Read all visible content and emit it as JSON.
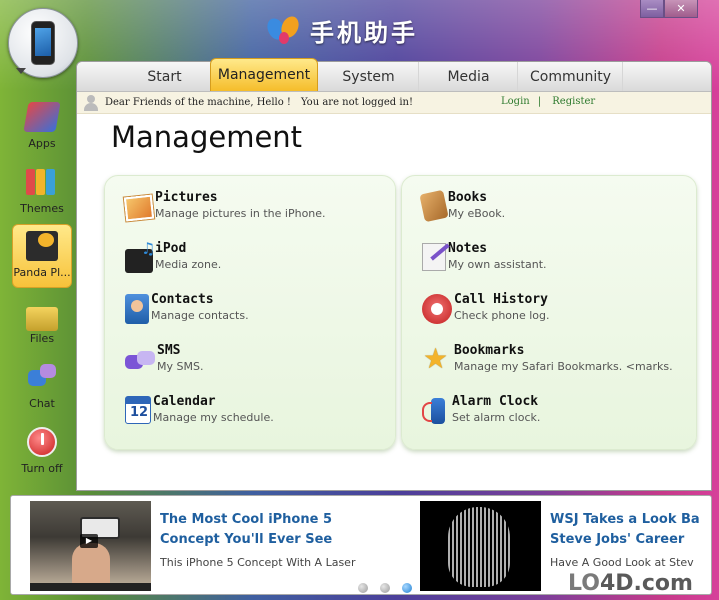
{
  "app": {
    "title": "手机助手"
  },
  "window_controls": {
    "minimize": "—",
    "close": "✕"
  },
  "sidebar": {
    "items": [
      {
        "label": "Apps",
        "icon": "apps-icon",
        "active": false
      },
      {
        "label": "Themes",
        "icon": "themes-icon",
        "active": false
      },
      {
        "label": "Panda Pl...",
        "icon": "panda-player-icon",
        "active": true
      },
      {
        "label": "Files",
        "icon": "folder-icon",
        "active": false
      },
      {
        "label": "Chat",
        "icon": "chat-icon",
        "active": false
      },
      {
        "label": "Turn off",
        "icon": "power-icon",
        "active": false
      }
    ]
  },
  "tabs": [
    {
      "label": "Start",
      "active": false
    },
    {
      "label": "Management",
      "active": true
    },
    {
      "label": "System",
      "active": false
    },
    {
      "label": "Media",
      "active": false
    },
    {
      "label": "Community",
      "active": false
    }
  ],
  "infobar": {
    "greeting": "Dear Friends of the machine, Hello !",
    "status": "You are not logged in!",
    "login": "Login",
    "separator": "|",
    "register": "Register"
  },
  "main": {
    "title": "Management",
    "left_card": [
      {
        "name": "Pictures",
        "desc": "Manage pictures in the iPhone.",
        "icon": "pictures-icon"
      },
      {
        "name": "iPod",
        "desc": "Media zone.",
        "icon": "ipod-icon"
      },
      {
        "name": "Contacts",
        "desc": "Manage contacts.",
        "icon": "contacts-icon"
      },
      {
        "name": "SMS",
        "desc": "My SMS.",
        "icon": "sms-icon"
      },
      {
        "name": "Calendar",
        "desc": "Manage my schedule.",
        "icon": "calendar-icon"
      }
    ],
    "right_card": [
      {
        "name": "Books",
        "desc": "My eBook.",
        "icon": "books-icon"
      },
      {
        "name": "Notes",
        "desc": "My own assistant.",
        "icon": "notes-icon"
      },
      {
        "name": "Call History",
        "desc": "Check phone log.",
        "icon": "call-history-icon"
      },
      {
        "name": "Bookmarks",
        "desc": "Manage my Safari Bookmarks. <marks.",
        "icon": "bookmarks-icon"
      },
      {
        "name": "Alarm Clock",
        "desc": "Set alarm clock.",
        "icon": "alarm-clock-icon"
      }
    ]
  },
  "news": {
    "items": [
      {
        "title_line1": "The Most Cool iPhone 5",
        "title_line2": "Concept You'll Ever See",
        "subtitle": "This iPhone 5 Concept With A Laser"
      },
      {
        "title_line1": "WSJ Takes a Look Ba",
        "title_line2": "Steve Jobs' Career",
        "subtitle": "Have A Good Look at Stev"
      }
    ],
    "dots": [
      {
        "active": false
      },
      {
        "active": false
      },
      {
        "active": true
      }
    ]
  },
  "watermark": {
    "prefix": "LO",
    "suffix": "4D.com"
  }
}
